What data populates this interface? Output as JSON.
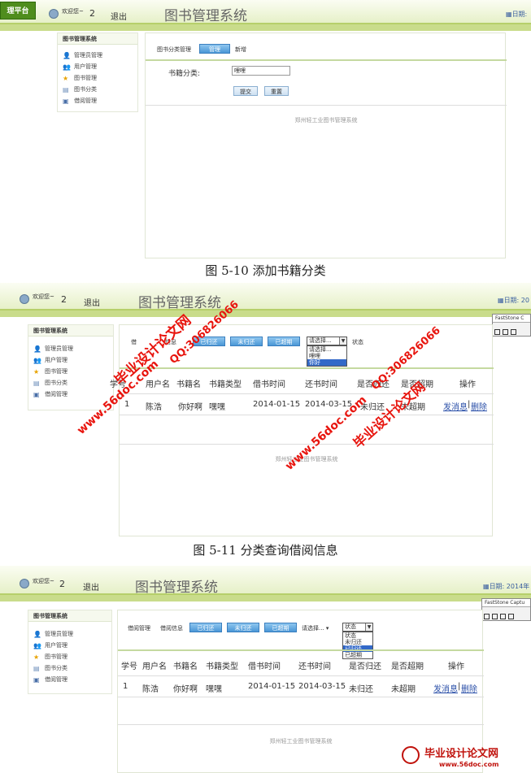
{
  "app": {
    "logo_text": "理平台",
    "welcome": "欢迎您~",
    "user_id": "2",
    "logout": "退出",
    "title": "图书管理系统",
    "date_label_1": "日期:",
    "date_label_2": "日期: 20",
    "date_label_3": "日期: 2014年",
    "footer": "郑州轻工业图书管理系统"
  },
  "sidebar": {
    "header": "图书管理系统",
    "items": [
      {
        "label": "管理员管理",
        "icon": "admin-icon"
      },
      {
        "label": "用户管理",
        "icon": "user-icon"
      },
      {
        "label": "图书管理",
        "icon": "star-icon"
      },
      {
        "label": "图书分类",
        "icon": "category-icon"
      },
      {
        "label": "借阅管理",
        "icon": "borrow-icon"
      }
    ]
  },
  "fig1": {
    "crumb": "图书分类管理",
    "manage_btn": "管理",
    "add_link": "新增",
    "field_label": "书籍分类:",
    "field_value": "哩哩",
    "submit": "提交",
    "reset": "重置",
    "caption": "图 5-10 添加书籍分类"
  },
  "fig2": {
    "crumb1": "借",
    "crumb2": "信息",
    "buttons": [
      "已归还",
      "未归还",
      "已超期"
    ],
    "select_value": "请选择...",
    "select_options": [
      "请选择...",
      "哩哩",
      "你好"
    ],
    "status_label": "状态",
    "caption": "图 5-11 分类查询借阅信息",
    "headers": [
      "学号",
      "用户名",
      "书籍名",
      "书籍类型",
      "借书时间",
      "还书时间",
      "是否归还",
      "是否超期",
      "操作"
    ],
    "row": [
      "1",
      "陈浩",
      "你好啊",
      "嘿嘿",
      "2014-01-15",
      "2014-03-15",
      "未归还",
      "未超期"
    ],
    "actions": [
      "发消息",
      "删除"
    ]
  },
  "fig3": {
    "crumb1": "借阅管理",
    "crumb2": "借阅信息",
    "buttons": [
      "已归还",
      "未归还",
      "已超期"
    ],
    "select_value": "请选择...",
    "status_value": "状态",
    "status_options": [
      "状态",
      "未归还",
      "已归还",
      "已超期"
    ],
    "headers": [
      "学号",
      "用户名",
      "书籍名",
      "书籍类型",
      "借书时间",
      "还书时间",
      "是否归还",
      "是否超期",
      "操作"
    ],
    "row": [
      "1",
      "陈浩",
      "你好啊",
      "嘿嘿",
      "2014-01-15",
      "2014-03-15",
      "未归还",
      "未超期"
    ],
    "actions": [
      "发消息",
      "删除"
    ]
  },
  "watermarks": {
    "site_name": "毕业设计论文网",
    "url": "www.56doc.com",
    "qq": "QQ:306826066"
  },
  "faststone": {
    "title_1": "FastStone C",
    "title_2": "FastStone Captu"
  },
  "colors": {
    "accent_green": "#b6cf6a",
    "button_blue": "#4a97d6",
    "watermark_red": "#e8150e"
  }
}
